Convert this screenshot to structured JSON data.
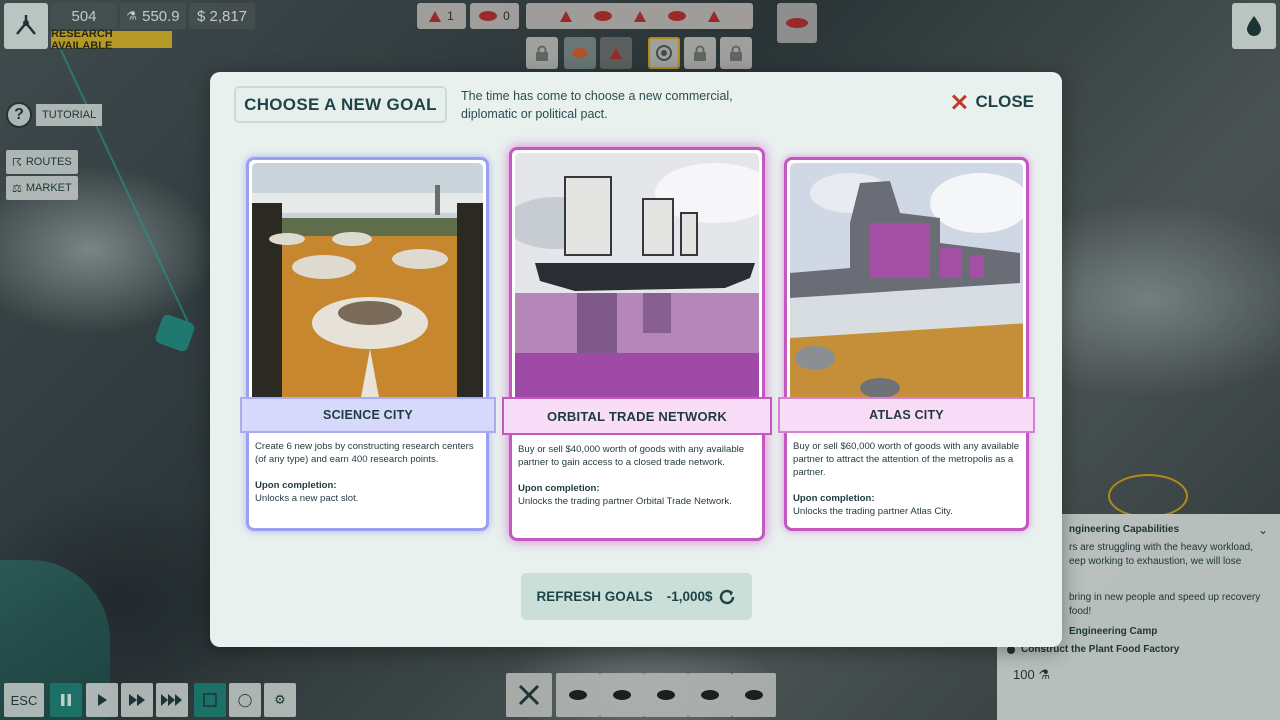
{
  "hud": {
    "research_points": "504",
    "science": "550.9",
    "money": "$ 2,817",
    "research_available": "RESEARCH AVAILABLE",
    "counter_a": "1",
    "counter_b": "0"
  },
  "side_menu": {
    "tutorial": "TUTORIAL",
    "routes": "ROUTES",
    "market": "MARKET",
    "help_glyph": "?"
  },
  "modal": {
    "title": "CHOOSE A NEW GOAL",
    "description": "The time has come to choose a new commercial, diplomatic or political pact.",
    "close_label": "CLOSE",
    "cards": [
      {
        "name": "SCIENCE CITY",
        "description": "Create 6 new jobs by constructing research centers (of any type) and earn 400 research points.",
        "completion_label": "Upon completion:",
        "completion_text": "Unlocks a new pact slot."
      },
      {
        "name": "ORBITAL TRADE NETWORK",
        "description": "Buy or sell $40,000 worth of goods with any available partner to gain access to a closed trade network.",
        "completion_label": "Upon completion:",
        "completion_text": "Unlocks the trading partner Orbital Trade Network."
      },
      {
        "name": "ATLAS CITY",
        "description": "Buy or sell $60,000 worth of goods with any available partner to attract the attention of the metropolis as a partner.",
        "completion_label": "Upon completion:",
        "completion_text": "Unlocks the trading partner Atlas City."
      }
    ],
    "refresh_label": "REFRESH GOALS",
    "refresh_cost": "-1,000$"
  },
  "quest_panel": {
    "title": "ngineering Capabilities",
    "line1": "rs are struggling with the heavy workload,",
    "line2": "eep working to exhaustion, we will lose",
    "line3": "bring in new people and speed up recovery",
    "line4": "food!",
    "item1": "Engineering Camp",
    "item2": "Construct the Plant Food Factory",
    "reward": "100"
  },
  "bottom_bar": {
    "esc": "ESC"
  },
  "colors": {
    "accent_teal": "#1d8378",
    "card_blue": "#9a9ff2",
    "card_magenta": "#c457c0",
    "close_red": "#c0392b",
    "research_yellow": "#d8b429"
  }
}
